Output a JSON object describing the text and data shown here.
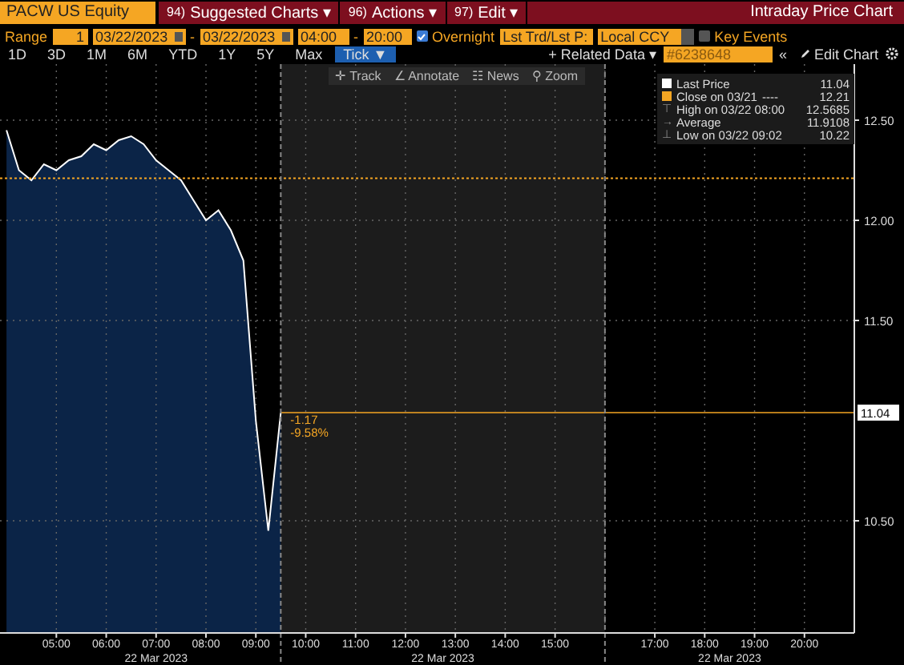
{
  "header": {
    "security": "PACW US Equity",
    "menus": [
      {
        "number": "94)",
        "label": "Suggested Charts",
        "caret": "▾"
      },
      {
        "number": "96)",
        "label": "Actions",
        "caret": "▾"
      },
      {
        "number": "97)",
        "label": "Edit",
        "caret": "▾"
      }
    ],
    "title": "Intraday Price Chart"
  },
  "range_bar": {
    "label": "Range",
    "period": "1",
    "start_date": "03/22/2023",
    "date_sep": "-",
    "end_date": "03/22/2023",
    "start_time": "04:00",
    "time_sep": "-",
    "end_time": "20:00",
    "overnight": {
      "label": "Overnight",
      "checked": true
    },
    "price_type": "Lst Trd/Lst P:",
    "currency": "Local CCY",
    "key_events": {
      "label": "Key Events",
      "checked": false
    }
  },
  "period_tabs": [
    {
      "label": "1D",
      "selected": false
    },
    {
      "label": "3D",
      "selected": false
    },
    {
      "label": "1M",
      "selected": false
    },
    {
      "label": "6M",
      "selected": false
    },
    {
      "label": "YTD",
      "selected": false
    },
    {
      "label": "1Y",
      "selected": false
    },
    {
      "label": "5Y",
      "selected": false
    },
    {
      "label": "Max",
      "selected": false
    },
    {
      "label": "Tick ▼",
      "selected": true
    }
  ],
  "tools_right": {
    "related": "+ Related Data ▾",
    "chart_id": "#6238648",
    "collapse": "«",
    "edit_chart": "Edit Chart"
  },
  "chart_toolbar": [
    {
      "label": "Track",
      "glyph": "✛"
    },
    {
      "label": "Annotate",
      "glyph": "∠"
    },
    {
      "label": "News",
      "glyph": "☷"
    },
    {
      "label": "Zoom",
      "glyph": "⚲"
    }
  ],
  "legend": [
    {
      "kind": "series",
      "color": "#ffffff",
      "value": "11.04"
    },
    {
      "kind": "box",
      "color": "#f5a623",
      "label": "Close on 03/21",
      "line_sample": "----",
      "value": "12.21"
    },
    {
      "kind": "marker",
      "glyph": "⊤",
      "label": "High on 03/22 08:00",
      "value": "12.5685"
    },
    {
      "kind": "marker",
      "glyph": "→",
      "label": "Average",
      "value": "11.9108"
    },
    {
      "kind": "marker",
      "glyph": "⊥",
      "label": "Low on 03/22 09:02",
      "value": "10.22"
    }
  ],
  "change": {
    "absolute": "-1.17",
    "percent": "-9.58%"
  },
  "last_price_tag": "11.04",
  "dates": [
    "22 Mar 2023",
    "22 Mar 2023",
    "22 Mar 2023"
  ],
  "chart_data": {
    "type": "area",
    "x": [
      4.0,
      4.25,
      4.5,
      4.75,
      5.0,
      5.25,
      5.5,
      5.75,
      6.0,
      6.25,
      6.5,
      6.75,
      7.0,
      7.25,
      7.5,
      7.75,
      8.0,
      8.25,
      8.5,
      8.75,
      9.0,
      9.25,
      9.5
    ],
    "series": [
      {
        "name": "Last Price",
        "color": "#ffffff",
        "values": [
          12.45,
          12.25,
          12.2,
          12.28,
          12.25,
          12.3,
          12.32,
          12.38,
          12.35,
          12.4,
          12.42,
          12.38,
          12.3,
          12.25,
          12.2,
          12.1,
          12.0,
          12.05,
          11.95,
          11.8,
          11.0,
          10.45,
          11.04
        ]
      }
    ],
    "xlim": [
      3.87,
      21.0
    ],
    "ylim": [
      9.94,
      12.78
    ],
    "grid": true,
    "xticks": [
      {
        "value": 5,
        "label": "05:00"
      },
      {
        "value": 6,
        "label": "06:00"
      },
      {
        "value": 7,
        "label": "07:00"
      },
      {
        "value": 8,
        "label": "08:00"
      },
      {
        "value": 9,
        "label": "09:00"
      },
      {
        "value": 10,
        "label": "10:00"
      },
      {
        "value": 11,
        "label": "11:00"
      },
      {
        "value": 12,
        "label": "12:00"
      },
      {
        "value": 13,
        "label": "13:00"
      },
      {
        "value": 14,
        "label": "14:00"
      },
      {
        "value": 15,
        "label": "15:00"
      },
      {
        "value": 17,
        "label": "17:00"
      },
      {
        "value": 18,
        "label": "18:00"
      },
      {
        "value": 19,
        "label": "19:00"
      },
      {
        "value": 20,
        "label": "20:00"
      }
    ],
    "yticks": [
      {
        "value": 12.5,
        "label": "12.50"
      },
      {
        "value": 12,
        "label": "12.00"
      },
      {
        "value": 11.5,
        "label": "11.50"
      },
      {
        "value": 10.5,
        "label": "10.50"
      }
    ],
    "ref_lines": [
      {
        "axis": "y",
        "value": 12.21,
        "color": "#f5a623"
      },
      {
        "axis": "y",
        "value": 11.04,
        "color": "#f5a623"
      },
      {
        "axis": "x",
        "value": 9.5,
        "color": "#888888"
      },
      {
        "axis": "x",
        "value": 16,
        "color": "#888888"
      }
    ]
  }
}
